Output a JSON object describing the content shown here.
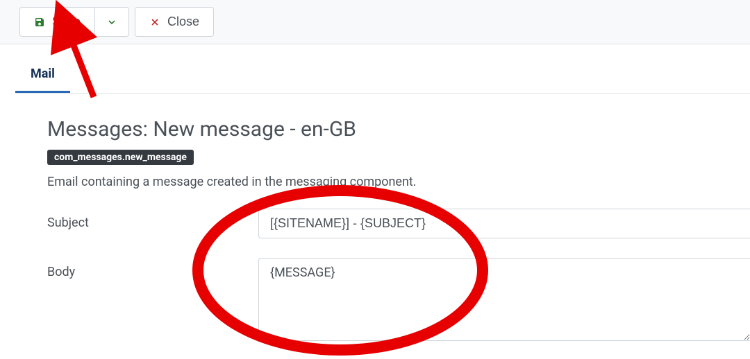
{
  "toolbar": {
    "save_label": "Save",
    "close_label": "Close"
  },
  "tabs": {
    "mail_label": "Mail"
  },
  "panel": {
    "title": "Messages: New message - en-GB",
    "component_key": "com_messages.new_message",
    "description": "Email containing a message created in the messaging component."
  },
  "form": {
    "subject_label": "Subject",
    "subject_value": "[{SITENAME}] - {SUBJECT}",
    "body_label": "Body",
    "body_value": "{MESSAGE}"
  }
}
